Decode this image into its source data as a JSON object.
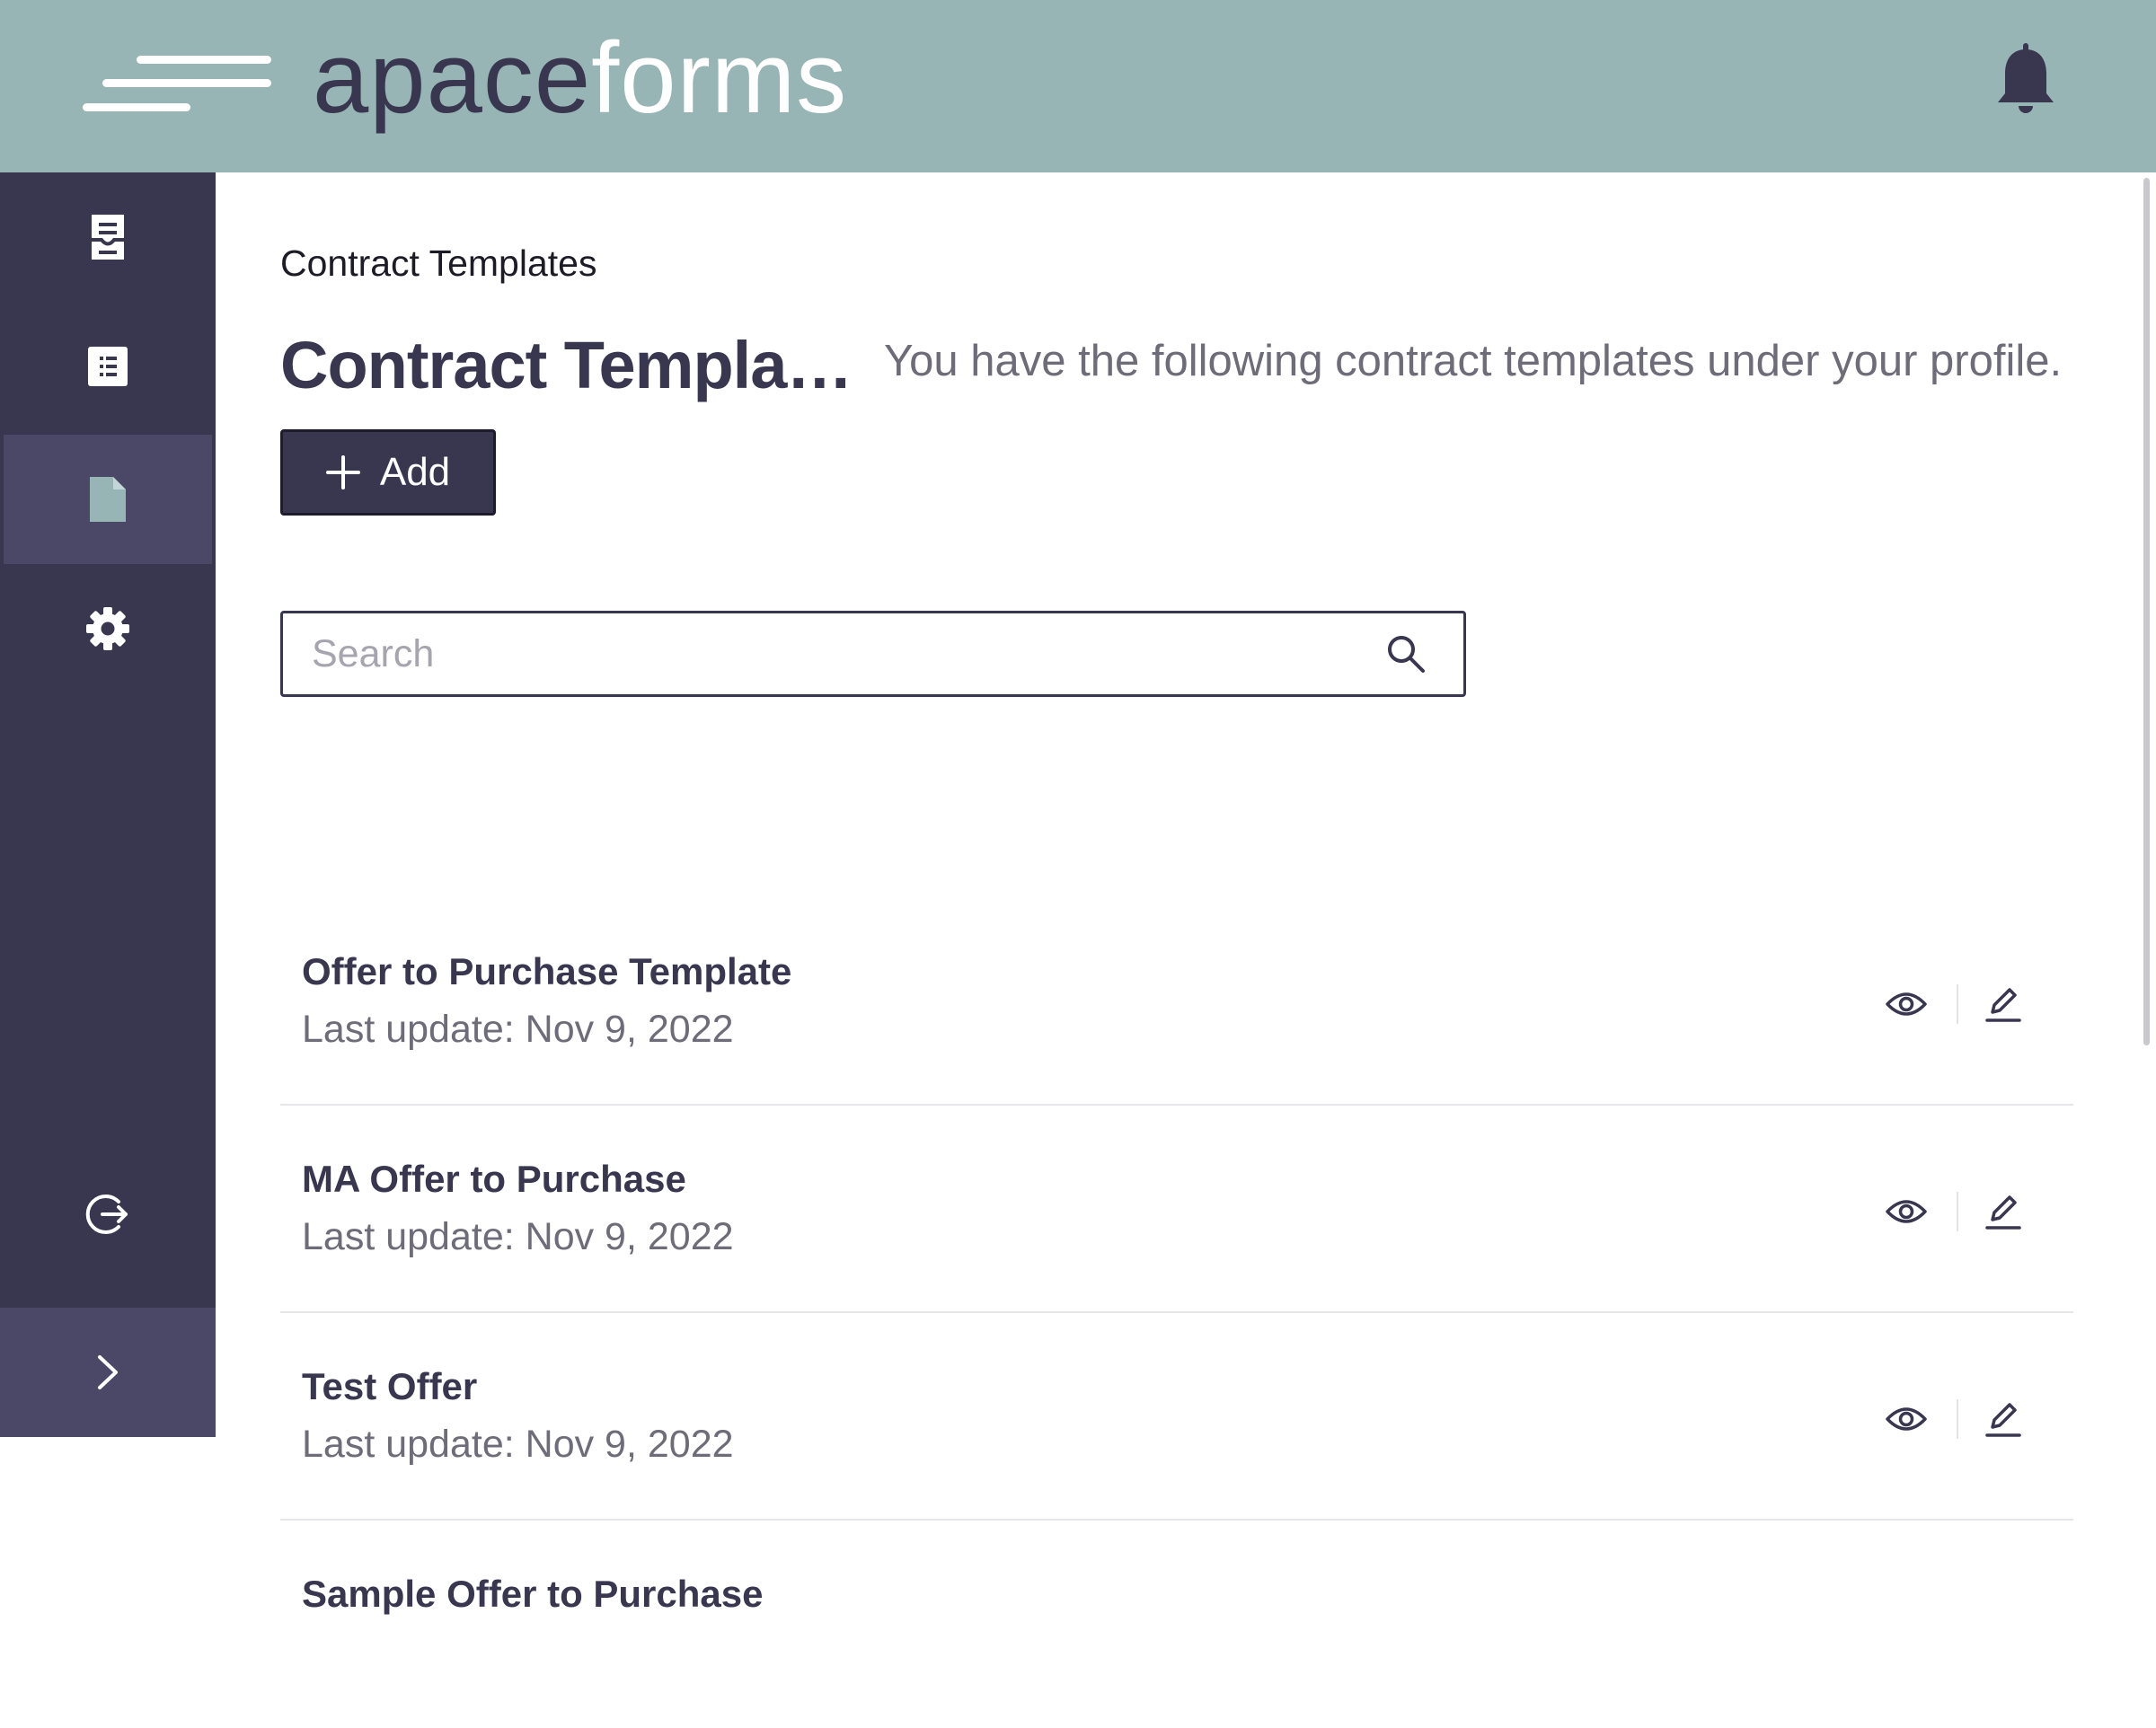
{
  "brand": {
    "logo_icon": "speed-lines-logo",
    "logo_part_dark": "apace",
    "logo_part_light": "forms"
  },
  "header": {
    "notification_icon": "bell-icon"
  },
  "sidebar": {
    "items": [
      {
        "name": "forms",
        "icon": "document-stack-icon"
      },
      {
        "name": "lists",
        "icon": "list-icon"
      },
      {
        "name": "contract-templates",
        "icon": "file-icon",
        "active": true
      },
      {
        "name": "settings",
        "icon": "gear-icon"
      }
    ],
    "logout_icon": "logout-icon",
    "collapse_icon": "chevron-right-icon"
  },
  "main": {
    "breadcrumb": "Contract Templates",
    "title": "Contract Templates",
    "subtitle": "You have the following contract templates under your profile.",
    "add_button_label": "Add",
    "search": {
      "placeholder": "Search",
      "value": ""
    },
    "templates": [
      {
        "name": "Offer to Purchase Template",
        "updated": "Last update: Nov 9, 2022"
      },
      {
        "name": "MA Offer to Purchase",
        "updated": "Last update: Nov 9, 2022"
      },
      {
        "name": "Test Offer",
        "updated": "Last update: Nov 9, 2022"
      },
      {
        "name": "Sample Offer to Purchase",
        "updated": ""
      }
    ],
    "row_actions": [
      "view-icon",
      "edit-icon"
    ]
  },
  "colors": {
    "header_bg": "#97b5b4",
    "sidebar_bg": "#393650",
    "sidebar_active": "#4b4766",
    "primary": "#393650",
    "muted_text": "#6e6c78"
  }
}
